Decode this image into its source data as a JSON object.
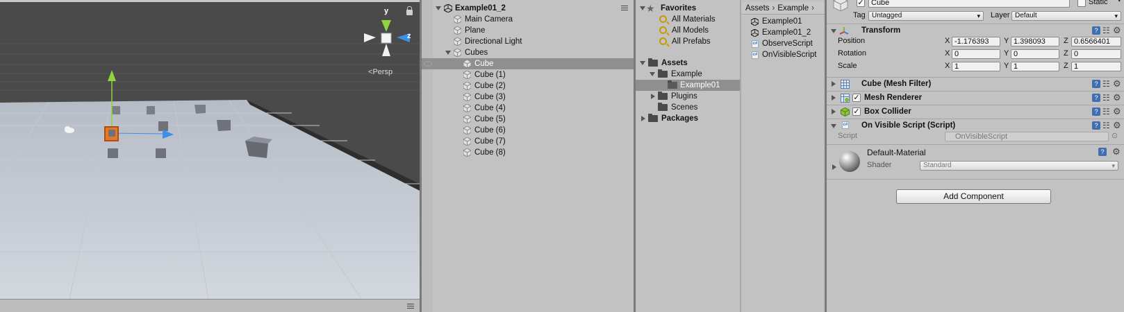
{
  "scene": {
    "persp_label": "Persp",
    "gizmo": {
      "y": "y",
      "z": "z"
    }
  },
  "hierarchy": {
    "scene_name": "Example01_2",
    "items": [
      {
        "label": "Main Camera"
      },
      {
        "label": "Plane"
      },
      {
        "label": "Directional Light"
      },
      {
        "label": "Cubes"
      },
      {
        "label": "Cube"
      },
      {
        "label": "Cube (1)"
      },
      {
        "label": "Cube (2)"
      },
      {
        "label": "Cube (3)"
      },
      {
        "label": "Cube (4)"
      },
      {
        "label": "Cube (5)"
      },
      {
        "label": "Cube (6)"
      },
      {
        "label": "Cube (7)"
      },
      {
        "label": "Cube (8)"
      }
    ]
  },
  "project": {
    "favorites_label": "Favorites",
    "favorites": [
      "All Materials",
      "All Models",
      "All Prefabs"
    ],
    "assets_label": "Assets",
    "tree": [
      "Example",
      "Example01",
      "Plugins",
      "Scenes"
    ],
    "packages_label": "Packages",
    "breadcrumb": [
      "Assets",
      "Example"
    ],
    "files": [
      "Example01",
      "Example01_2",
      "ObserveScript",
      "OnVisibleScript"
    ],
    "cs_icon_text": "c#"
  },
  "inspector": {
    "object_name": "Cube",
    "static_label": "Static",
    "tag_label": "Tag",
    "tag_value": "Untagged",
    "layer_label": "Layer",
    "layer_value": "Default",
    "transform": {
      "title": "Transform",
      "position_label": "Position",
      "rotation_label": "Rotation",
      "scale_label": "Scale",
      "axis": {
        "x": "X",
        "y": "Y",
        "z": "Z"
      },
      "position": {
        "x": "-1.176393",
        "y": "1.398093",
        "z": "0.6566401"
      },
      "rotation": {
        "x": "0",
        "y": "0",
        "z": "0"
      },
      "scale": {
        "x": "1",
        "y": "1",
        "z": "1"
      }
    },
    "mesh_filter_title": "Cube (Mesh Filter)",
    "mesh_renderer_title": "Mesh Renderer",
    "box_collider_title": "Box Collider",
    "script_component_title": "On Visible Script (Script)",
    "script_label": "Script",
    "script_value": "OnVisibleScript",
    "material_name": "Default-Material",
    "shader_label": "Shader",
    "shader_value": "Standard",
    "add_component_label": "Add Component",
    "help_glyph": "?"
  },
  "colors": {
    "selection": "#8f8f8f",
    "panel": "#c2c2c2",
    "gizmo_y": "#8fd43a",
    "gizmo_z": "#3d8fe8",
    "gizmo_x": "#e03030"
  }
}
